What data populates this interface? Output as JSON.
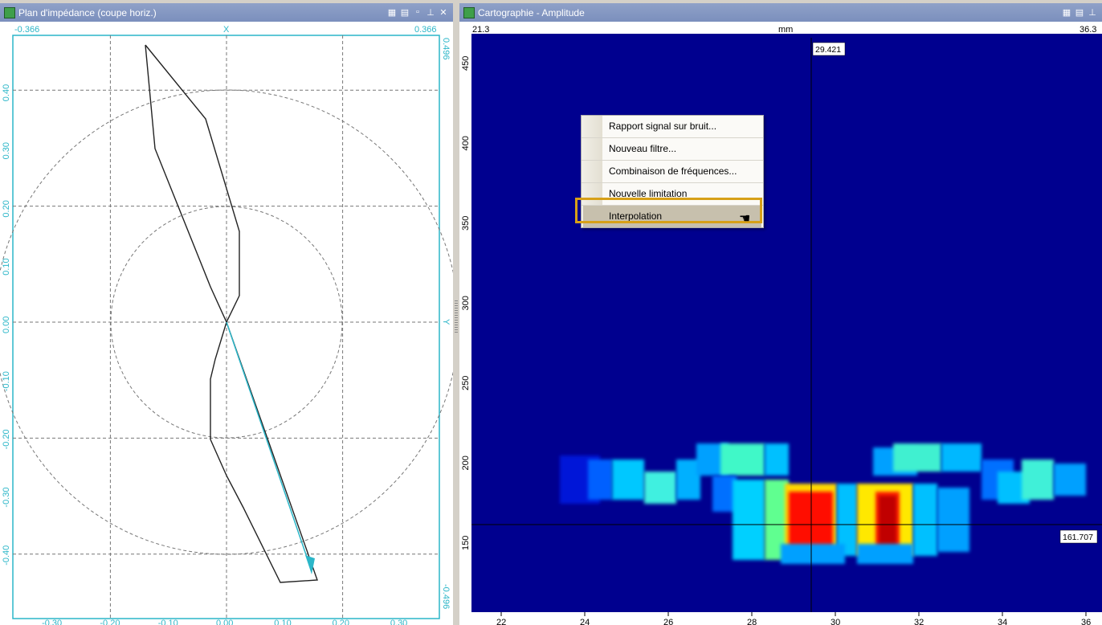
{
  "left_panel": {
    "title": "Plan d'impédance (coupe horiz.)",
    "x_axis_min": "-0.366",
    "x_axis_max": "0.366",
    "x_axis_name": "X",
    "y_axis_max": "0.496",
    "y_axis_min": "-0.496",
    "y_axis_name": "Y",
    "x_ticks": [
      "-0.30",
      "-0.20",
      "-0.10",
      "0.00",
      "0.10",
      "0.20",
      "0.30"
    ],
    "y_ticks": [
      "0.40",
      "0.30",
      "0.20",
      "0.10",
      "0.00",
      "-0.10",
      "-0.20",
      "-0.30",
      "-0.40"
    ],
    "accent_color": "#2bb6c8",
    "trace_color": "#222222"
  },
  "right_panel": {
    "title": "Cartographie - Amplitude",
    "x_range_min": "21.3",
    "x_range_max": "36.3",
    "x_unit": "mm",
    "cursor_x_value": "29.421",
    "cursor_y_value": "161.707",
    "x_ticks": [
      "22",
      "24",
      "26",
      "28",
      "30",
      "32",
      "34",
      "36"
    ],
    "y_ticks": [
      "450",
      "400",
      "350",
      "300",
      "250",
      "200",
      "150"
    ],
    "background_color": "#00008f"
  },
  "window_controls": {
    "opts_icon": "▦",
    "db_icon": "▤",
    "restore_icon": "▫",
    "pin_icon": "⊥",
    "close_icon": "✕"
  },
  "context_menu": {
    "items": [
      {
        "label": "Rapport signal sur bruit..."
      },
      {
        "label": "Nouveau filtre..."
      },
      {
        "label": "Combinaison de fréquences..."
      },
      {
        "label": "Nouvelle limitation"
      },
      {
        "label": "Interpolation"
      }
    ],
    "highlight_color": "#d7a018"
  }
}
